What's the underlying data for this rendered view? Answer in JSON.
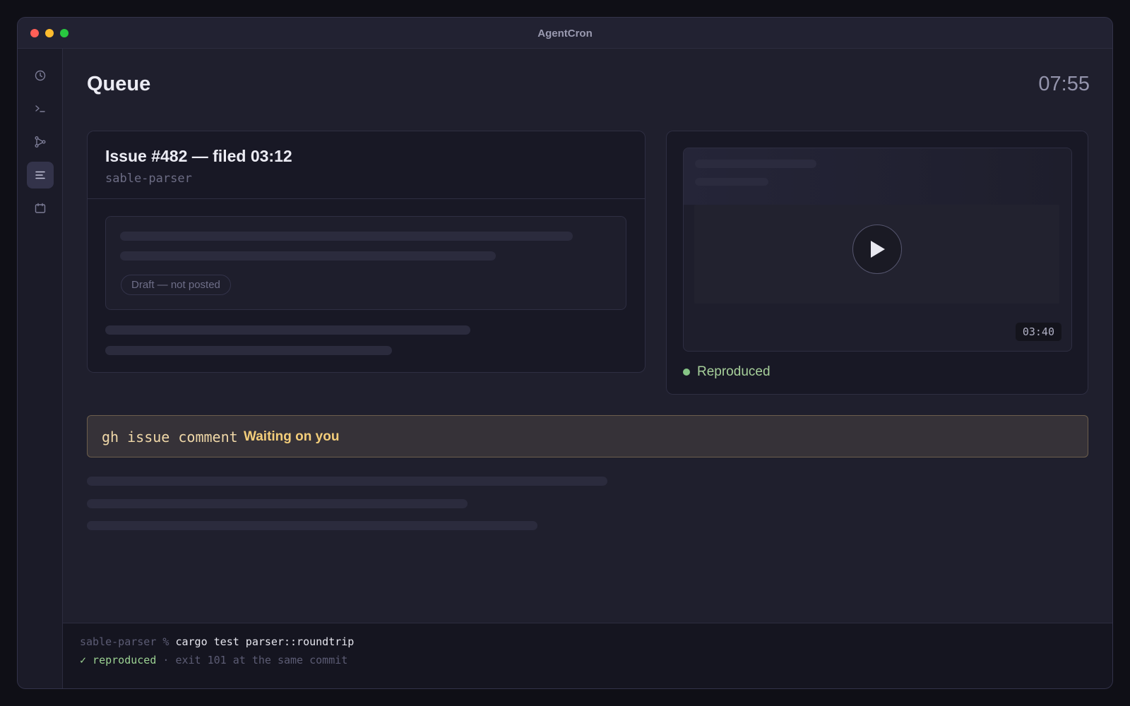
{
  "app": {
    "title": "AgentCron"
  },
  "sidebar": {
    "items": [
      {
        "icon": "clock-icon",
        "active": false
      },
      {
        "icon": "terminal-icon",
        "active": false
      },
      {
        "icon": "git-branch-icon",
        "active": false
      },
      {
        "icon": "list-icon",
        "active": true
      },
      {
        "icon": "calendar-icon",
        "active": false
      }
    ]
  },
  "header": {
    "title": "Queue",
    "time": "07:55"
  },
  "issue": {
    "title": "Issue #482 — filed 03:12",
    "repo": "sable-parser",
    "draft_badge": "Draft — not posted"
  },
  "recording": {
    "timecode": "03:40",
    "status": "Reproduced",
    "status_color": "#86c586"
  },
  "pending_action": {
    "command": "gh issue comment",
    "status": "Waiting on you",
    "accent": "#f3cd7a"
  },
  "terminal": {
    "prompt": "sable-parser % ",
    "command": "cargo test parser::roundtrip",
    "result_mark": "✓ reproduced",
    "result_detail": " · exit 101 at the same commit"
  }
}
